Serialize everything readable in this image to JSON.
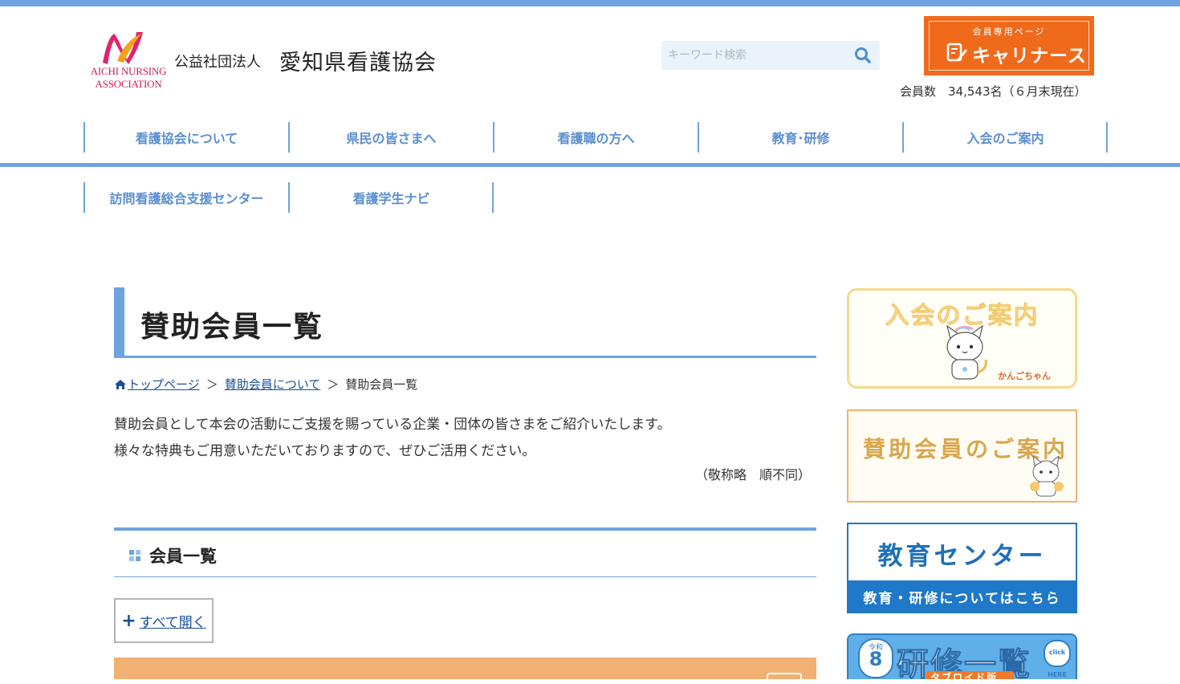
{
  "header": {
    "logo_en": "AICHI NURSING ASSOCIATION",
    "org_prefix": "公益社団法人",
    "org_name": "愛知県看護協会",
    "search_placeholder": "キーワード検索",
    "member_banner_sub": "会員専用ページ",
    "member_banner_main": "キャリナース",
    "member_count": "会員数　34,543名（６月末現在）"
  },
  "nav": {
    "row1": [
      "看護協会について",
      "県民の皆さまへ",
      "看護職の方へ",
      "教育･研修",
      "入会のご案内"
    ],
    "row2": [
      "訪問看護総合支援センター",
      "看護学生ナビ"
    ]
  },
  "main": {
    "title": "賛助会員一覧",
    "breadcrumb": [
      "トップページ",
      "賛助会員について",
      "賛助会員一覧"
    ],
    "intro_line1": "賛助会員として本会の活動にご支援を賜っている企業・団体の皆さまをご紹介いたします。",
    "intro_line2": "様々な特典もご用意いただいておりますので、ぜひご活用ください。",
    "note": "（敬称略　順不同）",
    "section_title": "会員一覧",
    "open_all_label": "すべて開く"
  },
  "sidebar": {
    "banner1_title": "入会のご案内",
    "banner1_caption": "かんごちゃん",
    "banner2_title": "賛助会員のご案内",
    "banner3_title": "教育センター",
    "banner3_sub": "教育・研修についてはこちら",
    "banner4_era": "令和",
    "banner4_year": "8",
    "banner4_title": "研修一覧",
    "banner4_strip": "タブロイド版",
    "banner4_click": "click HERE"
  },
  "colors": {
    "accent": "#6fa3df",
    "nav_text": "#5a8fd0",
    "brand_orange": "#f06a1c",
    "accordion": "#f0b173"
  }
}
